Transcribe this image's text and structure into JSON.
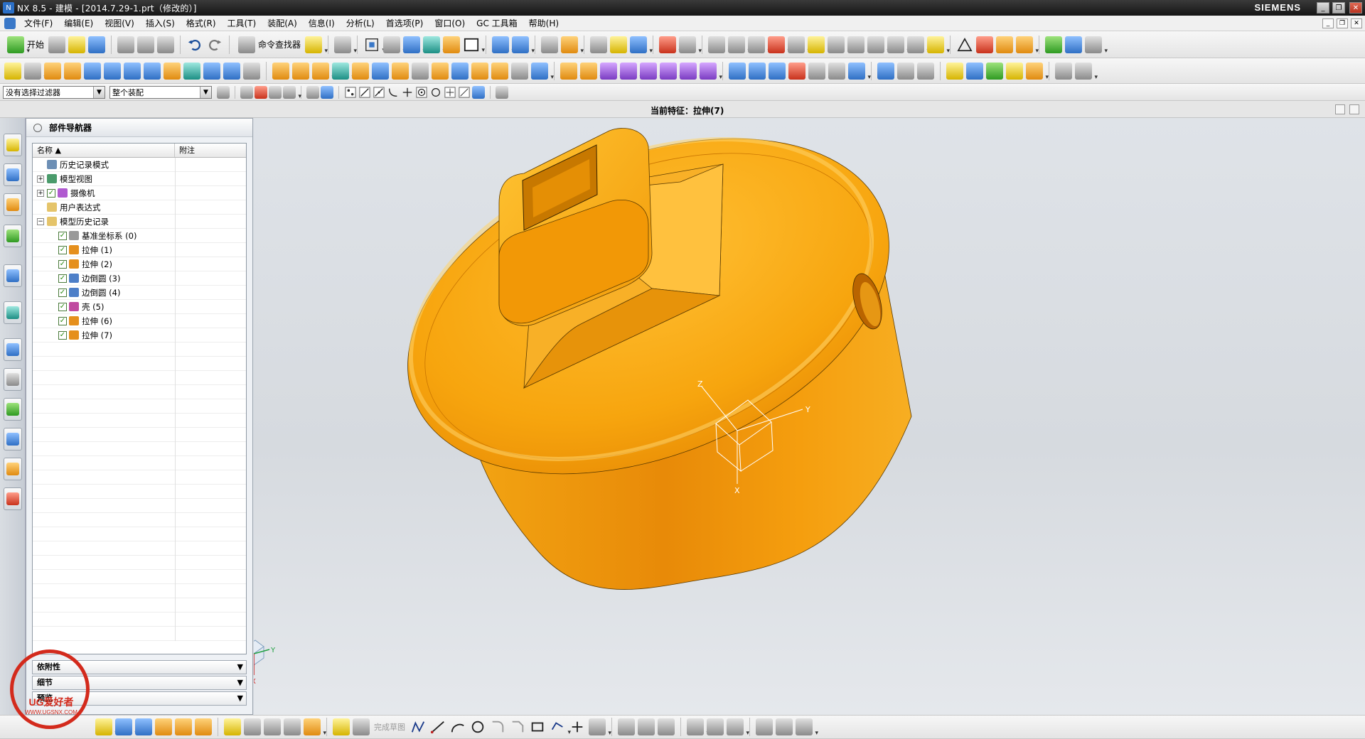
{
  "window": {
    "title": "NX 8.5 - 建模 - [2014.7.29-1.prt（修改的）]",
    "brand": "SIEMENS",
    "controls": [
      "_",
      "❐",
      "✕"
    ]
  },
  "menu": {
    "items": [
      "文件(F)",
      "编辑(E)",
      "视图(V)",
      "插入(S)",
      "格式(R)",
      "工具(T)",
      "装配(A)",
      "信息(I)",
      "分析(L)",
      "首选项(P)",
      "窗口(O)",
      "GC 工具箱",
      "帮助(H)"
    ]
  },
  "toolbar": {
    "start_label": "开始",
    "command_finder_label": "命令查找器"
  },
  "selection": {
    "filter_value": "没有选择过滤器",
    "scope_value": "整个装配"
  },
  "status": {
    "current_feature": "当前特征：拉伸(7)"
  },
  "navigator": {
    "title": "部件导航器",
    "columns": [
      "名称",
      "附注"
    ],
    "rows": [
      {
        "label": "历史记录模式",
        "level": 1,
        "expander": "",
        "check": false,
        "icon": "clock-icon"
      },
      {
        "label": "模型视图",
        "level": 1,
        "expander": "+",
        "check": false,
        "icon": "model-view-icon"
      },
      {
        "label": "摄像机",
        "level": 1,
        "expander": "+",
        "check": true,
        "icon": "camera-icon"
      },
      {
        "label": "用户表达式",
        "level": 1,
        "expander": "",
        "check": false,
        "icon": "folder-icon"
      },
      {
        "label": "模型历史记录",
        "level": 1,
        "expander": "−",
        "check": false,
        "icon": "folder-icon"
      },
      {
        "label": "基准坐标系 (0)",
        "level": 2,
        "expander": "",
        "check": true,
        "icon": "datum-csys-icon"
      },
      {
        "label": "拉伸 (1)",
        "level": 2,
        "expander": "",
        "check": true,
        "icon": "extrude-icon"
      },
      {
        "label": "拉伸 (2)",
        "level": 2,
        "expander": "",
        "check": true,
        "icon": "extrude-icon"
      },
      {
        "label": "边倒圆 (3)",
        "level": 2,
        "expander": "",
        "check": true,
        "icon": "edge-blend-icon"
      },
      {
        "label": "边倒圆 (4)",
        "level": 2,
        "expander": "",
        "check": true,
        "icon": "edge-blend-icon"
      },
      {
        "label": "壳 (5)",
        "level": 2,
        "expander": "",
        "check": true,
        "icon": "shell-icon"
      },
      {
        "label": "拉伸 (6)",
        "level": 2,
        "expander": "",
        "check": true,
        "icon": "extrude-icon"
      },
      {
        "label": "拉伸 (7)",
        "level": 2,
        "expander": "",
        "check": true,
        "icon": "extrude-icon"
      }
    ],
    "subpanels": [
      "依附性",
      "细节",
      "预览"
    ]
  },
  "bottom_toolbar": {
    "finish_sketch_label": "完成草图"
  },
  "viewport": {
    "csys_axes": [
      "X",
      "Y",
      "Z"
    ],
    "triad_axes": [
      "X",
      "Y",
      "Z"
    ],
    "body_color": "#f5a00e"
  },
  "watermark": {
    "text": "UG爱好者",
    "url": "WWW.UGSNX.COM"
  }
}
